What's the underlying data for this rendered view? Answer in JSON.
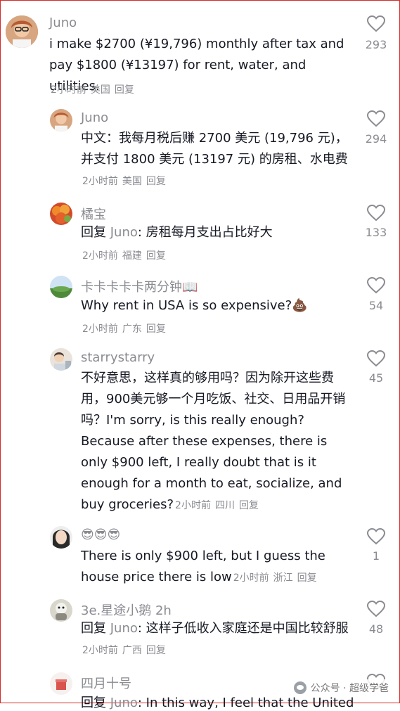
{
  "comments": [
    {
      "username": "Juno",
      "text": "i make $2700 (¥19,796) monthly after tax and pay $1800 (¥13197) for rent, water, and utilities.",
      "time": "2小时前",
      "location": "美国",
      "reply": "回复",
      "likes": "293"
    },
    {
      "username": "Juno",
      "text": "中文：我每月税后赚 2700 美元 (19,796 元)，并支付 1800 美元 (13197 元) 的房租、水电费",
      "time": "2小时前",
      "location": "美国",
      "reply": "回复",
      "likes": "294"
    },
    {
      "username": "橘宝",
      "reply_prefix": "回复",
      "mention": "Juno",
      "text": ": 房租每月支出占比好大",
      "time": "2小时前",
      "location": "福建",
      "reply": "回复",
      "likes": "133"
    },
    {
      "username": "卡卡卡卡卡两分钟📖",
      "text": "Why rent in USA is so expensive?",
      "emoji": "💩",
      "time": "2小时前",
      "location": "广东",
      "reply": "回复",
      "likes": "54"
    },
    {
      "username": "starrystarry",
      "text": "不好意思，这样真的够用吗？因为除开这些费用，900美元够一个月吃饭、社交、日用品开销吗？I'm sorry, is this really enough? Because after these expenses, there is only $900 left, I really doubt that is it enough for a month to eat, socialize, and buy groceries?",
      "time": "2小时前",
      "location": "四川",
      "reply": "回复",
      "likes": "45"
    },
    {
      "username": "😎😎😎",
      "text": "There is only $900 left, but I guess the house price there is low",
      "time": "2小时前",
      "location": "浙江",
      "reply": "回复",
      "likes": "1"
    },
    {
      "username": "3e.星途小鹅 2h",
      "reply_prefix": "回复",
      "mention": "Juno",
      "text": ": 这样子低收入家庭还是中国比较舒服",
      "time": "2小时前",
      "location": "广西",
      "reply": "回复",
      "likes": "48"
    },
    {
      "username": "四月十号",
      "reply_prefix": "回复",
      "mention": "Juno",
      "text": ": In this way, I feel that the United",
      "likes": ""
    }
  ],
  "watermark": {
    "text": "公众号 · 超级学爸"
  },
  "colors": {
    "frame": "#d52b2b",
    "secondary_text": "#8a8b91",
    "primary_text": "#161823"
  }
}
